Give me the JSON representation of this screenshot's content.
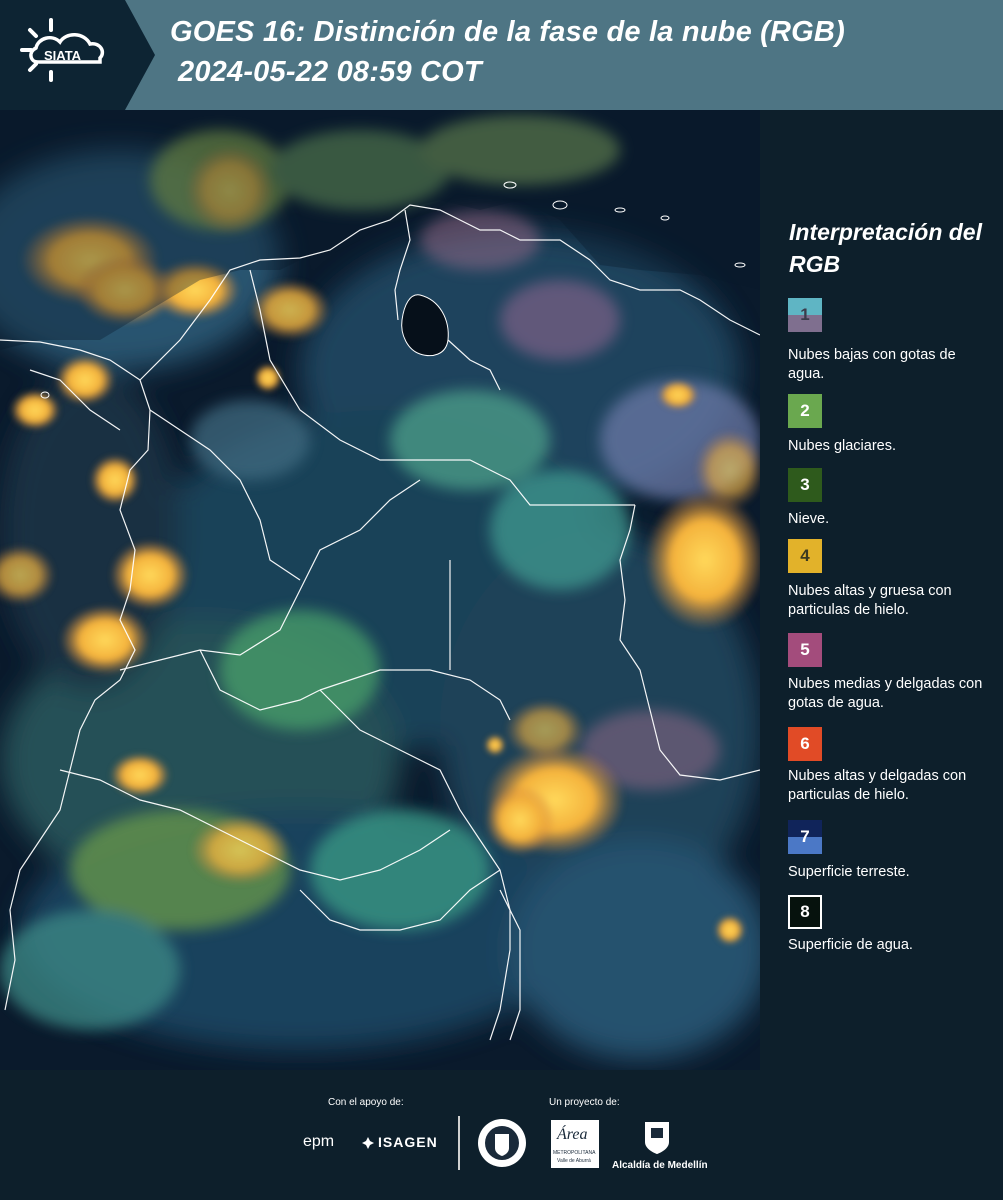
{
  "header": {
    "logo_text": "SIATA",
    "title_line1": "GOES 16: Distinción de la fase de la nube (RGB)",
    "title_line2": "2024-05-22 08:59 COT"
  },
  "legend": {
    "title": "Interpretación del RGB",
    "items": [
      {
        "num": "1",
        "label": "Nubes bajas con gotas de agua.",
        "color": "#5fb5c4"
      },
      {
        "num": "2",
        "label": "Nubes glaciares.",
        "color": "#6aa84f"
      },
      {
        "num": "3",
        "label": "Nieve.",
        "color": "#2e5a1c"
      },
      {
        "num": "4",
        "label": "Nubes altas y gruesa con particulas de hielo.",
        "color": "#e2b22a"
      },
      {
        "num": "5",
        "label": "Nubes medias y delgadas con gotas de agua.",
        "color": "#a34c7c"
      },
      {
        "num": "6",
        "label": "Nubes altas y delgadas con particulas de hielo.",
        "color": "#e14b26"
      },
      {
        "num": "7",
        "label": "Superficie terreste.",
        "color": "#10245a"
      },
      {
        "num": "8",
        "label": "Superficie de agua.",
        "color": "#06120d"
      }
    ]
  },
  "footer": {
    "support_label": "Con el apoyo de:",
    "project_label": "Un proyecto de:",
    "epm": "epm",
    "isagen": "ISAGEN",
    "area_metro": "Área",
    "area_metro_sub": "METROPOLITANA",
    "area_metro_sub2": "Valle de Aburrá",
    "alcaldia": "Alcaldía de Medellín"
  }
}
